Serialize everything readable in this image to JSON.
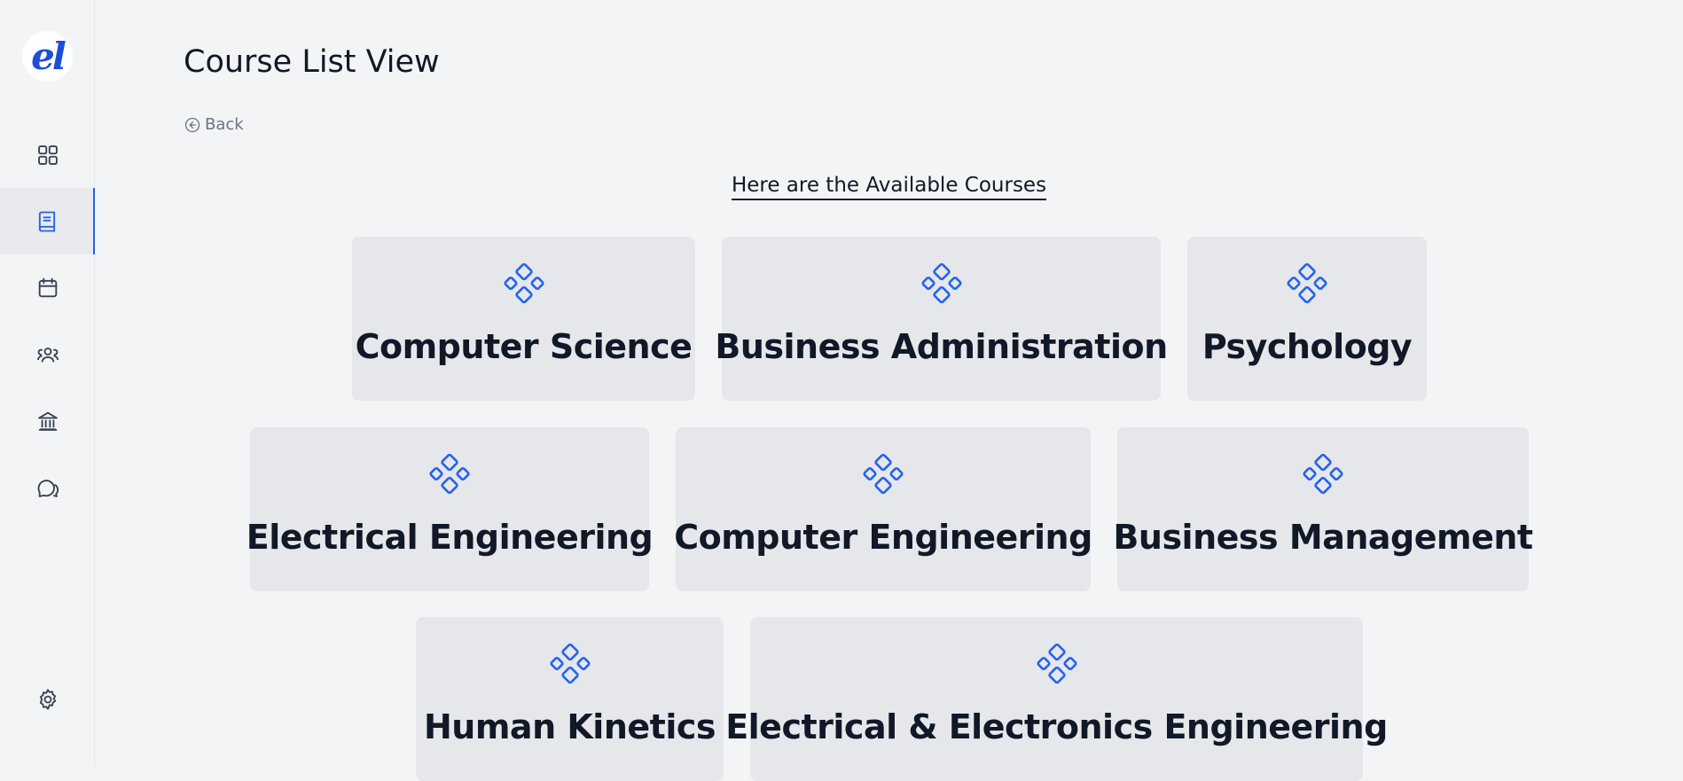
{
  "app": {
    "logo_text": "el",
    "accent": "#2563eb"
  },
  "sidebar": {
    "items": [
      {
        "name": "dashboard",
        "icon": "grid-icon"
      },
      {
        "name": "courses",
        "icon": "book-icon",
        "active": true
      },
      {
        "name": "calendar",
        "icon": "calendar-icon"
      },
      {
        "name": "people",
        "icon": "users-icon"
      },
      {
        "name": "institution",
        "icon": "bank-icon"
      },
      {
        "name": "messages",
        "icon": "chat-icon"
      }
    ],
    "settings": {
      "icon": "gear-icon"
    }
  },
  "header": {
    "title": "Course List View",
    "back_label": "Back"
  },
  "main": {
    "heading": "Here are the Available Courses",
    "courses": [
      {
        "title": "Computer Science",
        "icon": "component-icon"
      },
      {
        "title": "Business Administration",
        "icon": "component-icon"
      },
      {
        "title": "Psychology",
        "icon": "component-icon"
      },
      {
        "title": "Electrical Engineering",
        "icon": "component-icon"
      },
      {
        "title": "Computer Engineering",
        "icon": "component-icon"
      },
      {
        "title": "Business Management",
        "icon": "component-icon"
      },
      {
        "title": "Human Kinetics",
        "icon": "component-icon"
      },
      {
        "title": "Electrical & Electronics Engineering",
        "icon": "component-icon"
      }
    ]
  }
}
